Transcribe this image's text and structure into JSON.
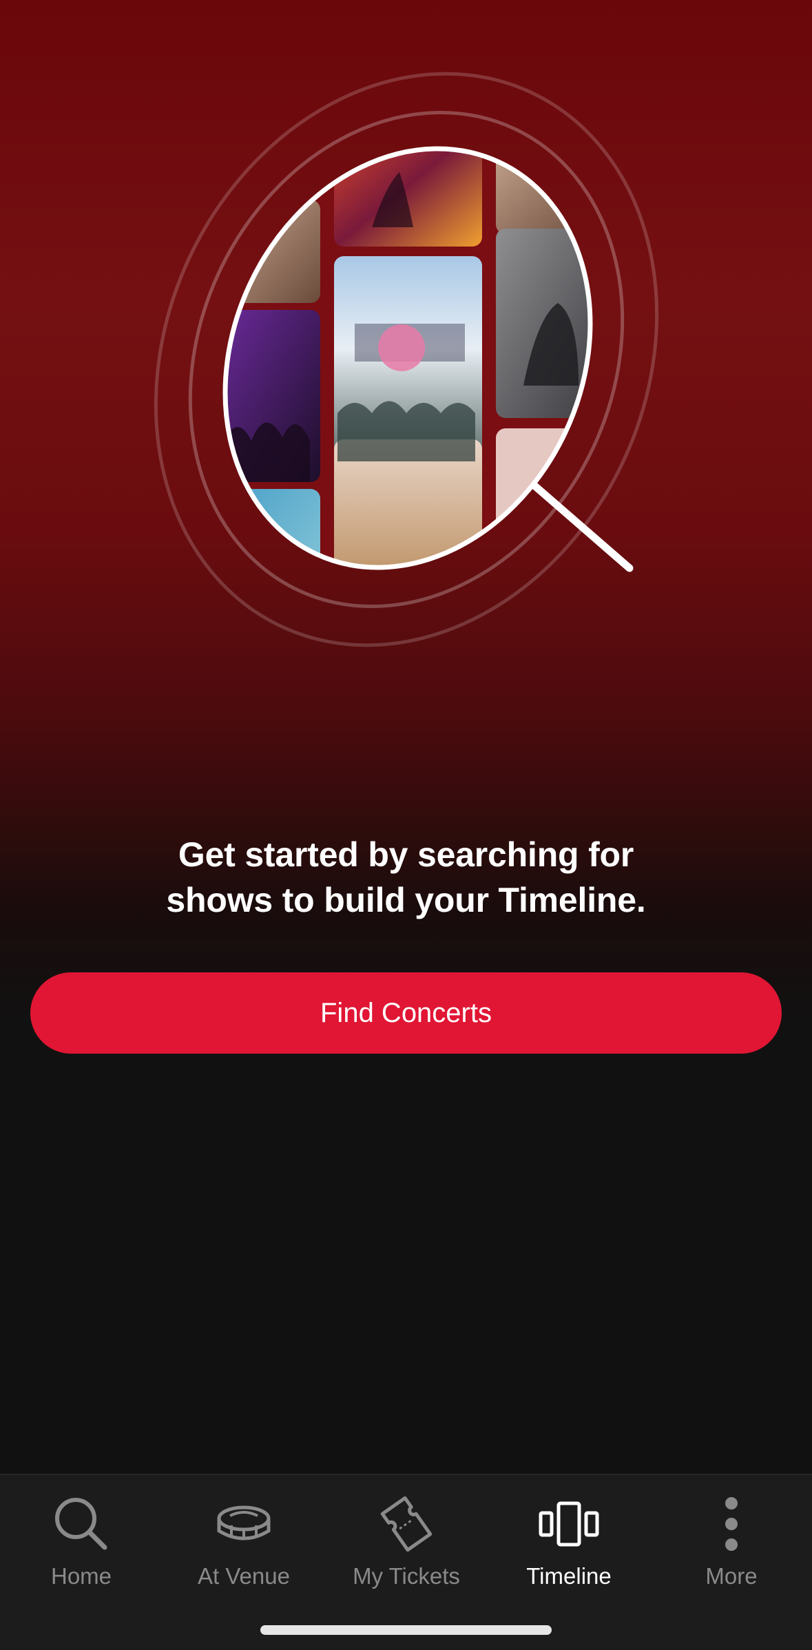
{
  "message": {
    "headline_line1": "Get started by searching for",
    "headline_line2": "shows to build your Timeline."
  },
  "cta": {
    "label": "Find Concerts"
  },
  "tabs": [
    {
      "label": "Home",
      "icon": "search-icon",
      "active": false
    },
    {
      "label": "At Venue",
      "icon": "stadium-icon",
      "active": false
    },
    {
      "label": "My Tickets",
      "icon": "ticket-icon",
      "active": false
    },
    {
      "label": "Timeline",
      "icon": "timeline-icon",
      "active": true
    },
    {
      "label": "More",
      "icon": "more-vertical-icon",
      "active": false
    }
  ],
  "colors": {
    "accent": "#e11634",
    "background": "#111111",
    "hero_red": "#741012",
    "tab_inactive": "#8a8a8a",
    "tab_active": "#ffffff"
  }
}
